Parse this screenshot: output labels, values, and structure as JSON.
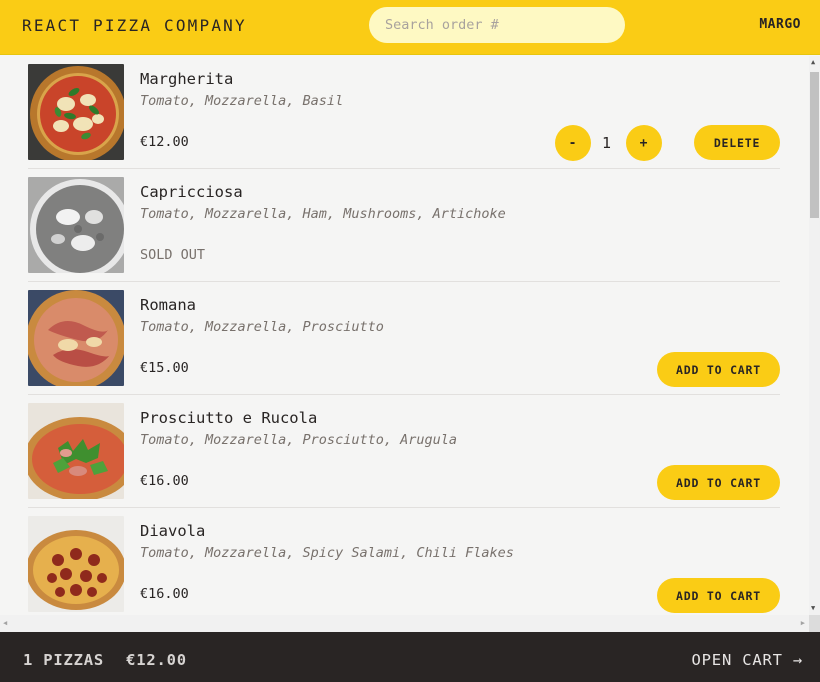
{
  "header": {
    "logo": "REACT PIZZA COMPANY",
    "search_placeholder": "Search order #",
    "username": "MARGO"
  },
  "menu": [
    {
      "name": "Margherita",
      "ingredients": "Tomato, Mozzarella, Basil",
      "price": "€12.00",
      "sold_out": false,
      "in_cart": true,
      "quantity": "1",
      "minus_label": "-",
      "plus_label": "+",
      "delete_label": "DELETE"
    },
    {
      "name": "Capricciosa",
      "ingredients": "Tomato, Mozzarella, Ham, Mushrooms, Artichoke",
      "sold_out": true,
      "sold_out_label": "SOLD OUT"
    },
    {
      "name": "Romana",
      "ingredients": "Tomato, Mozzarella, Prosciutto",
      "price": "€15.00",
      "sold_out": false,
      "add_label": "ADD TO CART"
    },
    {
      "name": "Prosciutto e Rucola",
      "ingredients": "Tomato, Mozzarella, Prosciutto, Arugula",
      "price": "€16.00",
      "sold_out": false,
      "add_label": "ADD TO CART"
    },
    {
      "name": "Diavola",
      "ingredients": "Tomato, Mozzarella, Spicy Salami, Chili Flakes",
      "price": "€16.00",
      "sold_out": false,
      "add_label": "ADD TO CART"
    }
  ],
  "footer": {
    "pizza_count": "1 PIZZAS",
    "total": "€12.00",
    "open_cart": "OPEN CART →"
  },
  "colors": {
    "accent": "#facc15",
    "search_bg": "#fef9c3",
    "footer_bg": "#292524",
    "page_bg": "#f5f5f4"
  }
}
